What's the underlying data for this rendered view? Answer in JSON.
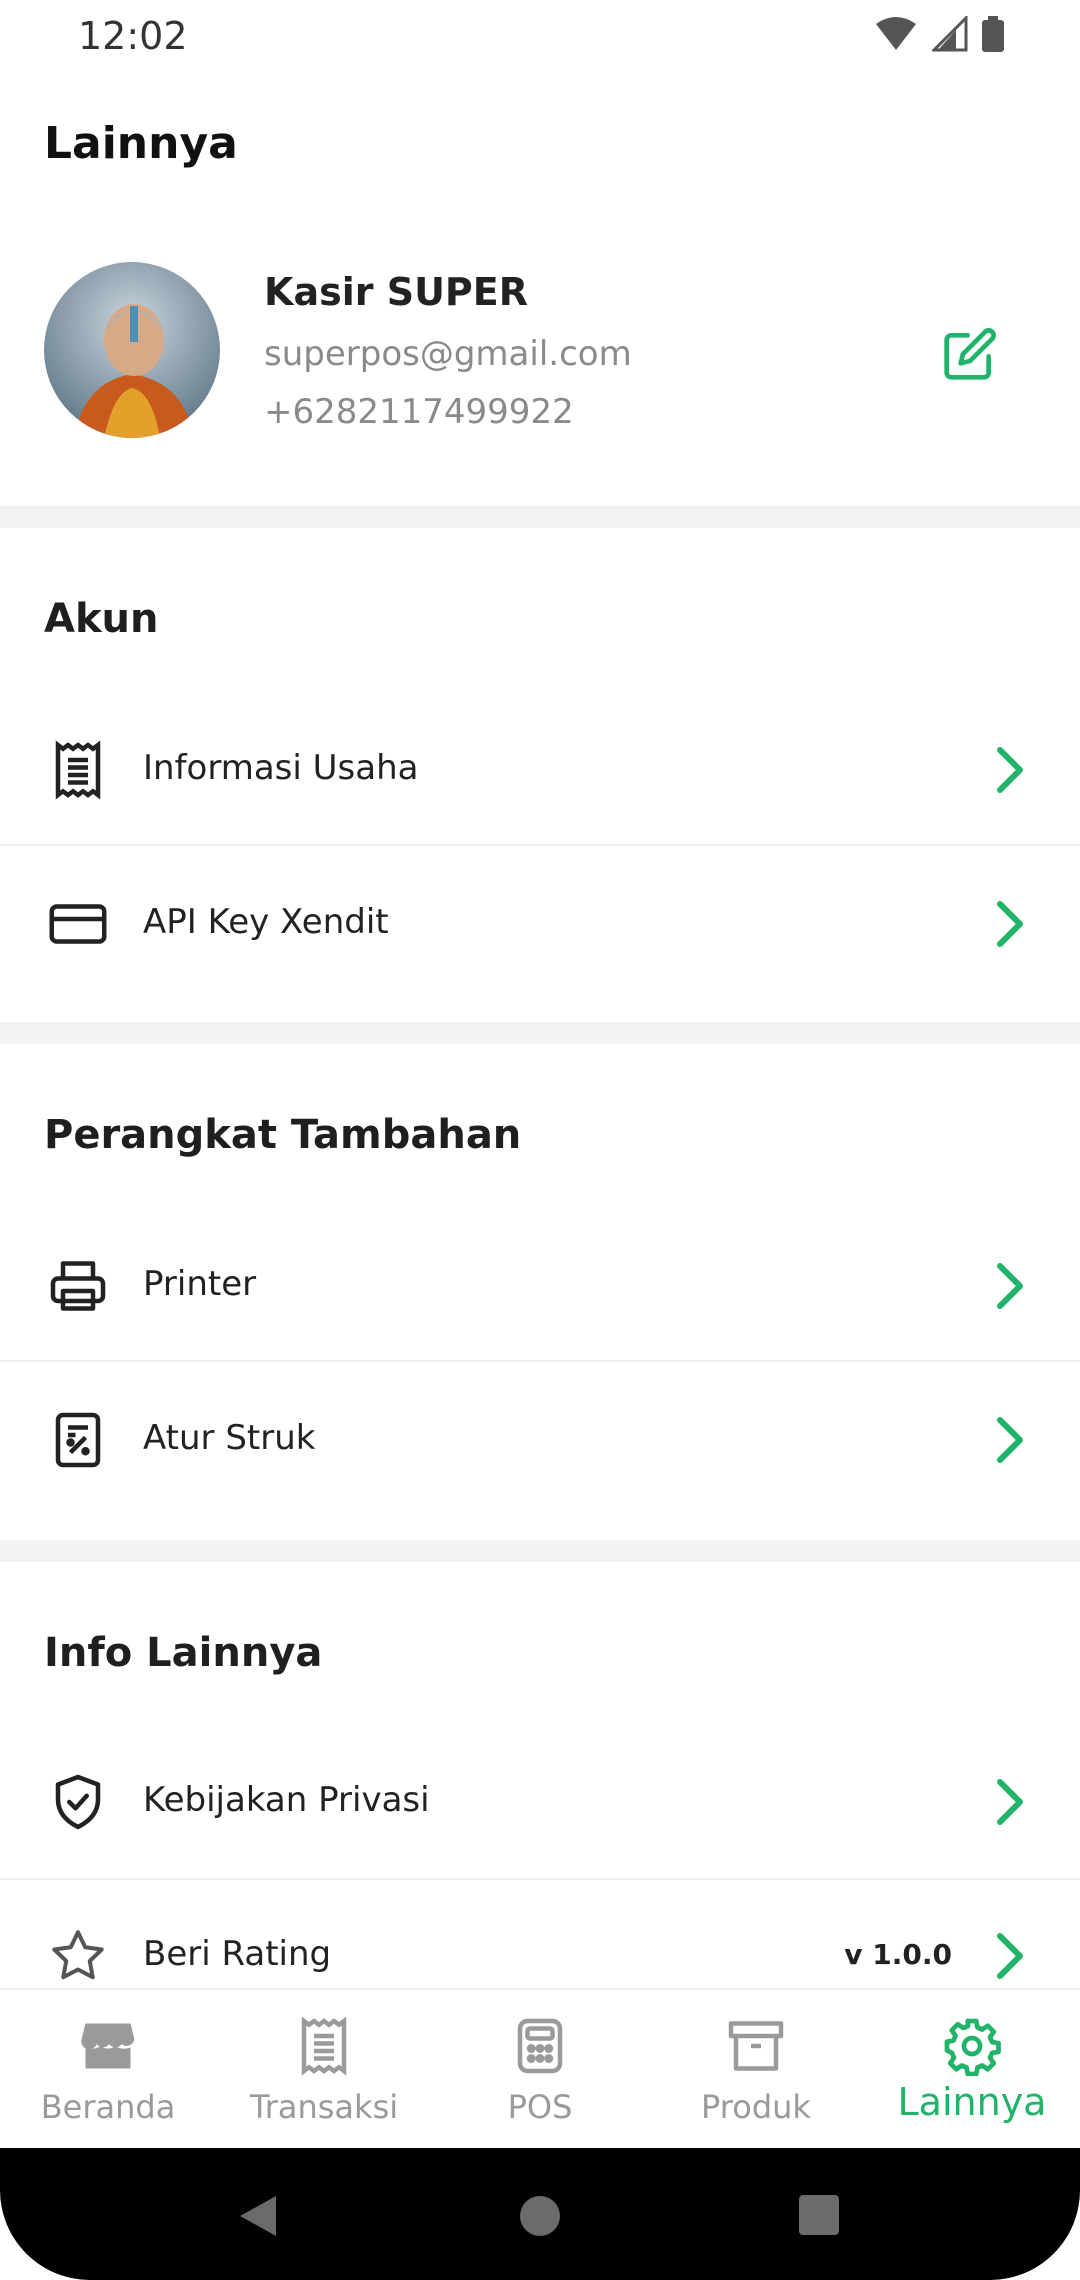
{
  "status": {
    "time": "12:02"
  },
  "header": {
    "title": "Lainnya"
  },
  "profile": {
    "name": "Kasir SUPER",
    "email": "superpos@gmail.com",
    "phone": "+6282117499922"
  },
  "sections": {
    "akun": {
      "title": "Akun",
      "items": [
        {
          "label": "Informasi Usaha",
          "icon": "receipt-icon"
        },
        {
          "label": "API Key Xendit",
          "icon": "credit-card-icon"
        }
      ]
    },
    "perangkat": {
      "title": "Perangkat Tambahan",
      "items": [
        {
          "label": "Printer",
          "icon": "printer-icon"
        },
        {
          "label": "Atur Struk",
          "icon": "receipt-settings-icon"
        }
      ]
    },
    "info": {
      "title": "Info Lainnya",
      "items": [
        {
          "label": "Kebijakan Privasi",
          "icon": "shield-check-icon"
        },
        {
          "label": "Beri Rating",
          "icon": "star-icon",
          "version": "v 1.0.0"
        }
      ]
    }
  },
  "nav": {
    "items": [
      {
        "label": "Beranda",
        "icon": "store-icon"
      },
      {
        "label": "Transaksi",
        "icon": "receipt-icon"
      },
      {
        "label": "POS",
        "icon": "calculator-icon"
      },
      {
        "label": "Produk",
        "icon": "archive-icon"
      },
      {
        "label": "Lainnya",
        "icon": "gear-icon"
      }
    ],
    "active": "Lainnya"
  },
  "colors": {
    "accent": "#22b36a",
    "muted": "#8a8a8a",
    "separator": "#f2f2f2"
  }
}
